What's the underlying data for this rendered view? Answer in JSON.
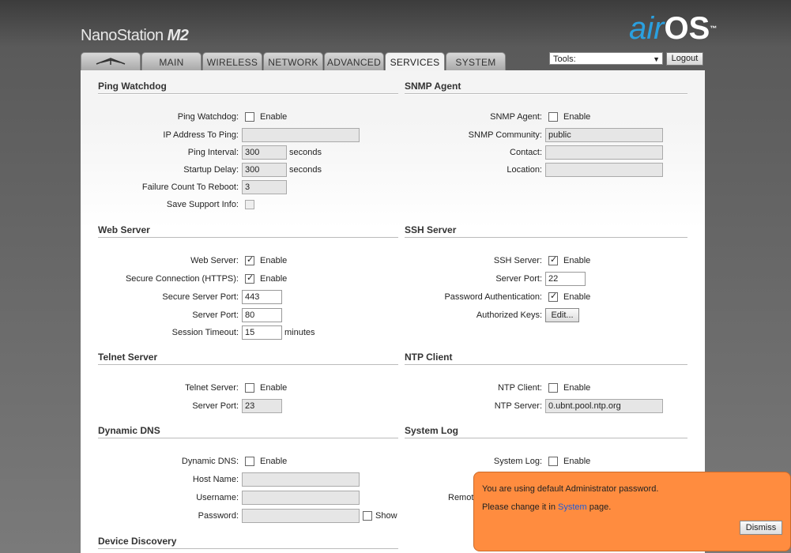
{
  "header": {
    "product_name": "NanoStation",
    "product_model": "M2",
    "logo_air": "air",
    "logo_os": "OS",
    "logo_tm": "™"
  },
  "tabs": [
    {
      "label": "",
      "icon": "ubiquiti-logo-icon"
    },
    {
      "label": "MAIN"
    },
    {
      "label": "WIRELESS"
    },
    {
      "label": "NETWORK"
    },
    {
      "label": "ADVANCED"
    },
    {
      "label": "SERVICES"
    },
    {
      "label": "SYSTEM"
    }
  ],
  "tools": {
    "selected": "Tools:"
  },
  "logout_label": "Logout",
  "ping_watchdog": {
    "title": "Ping Watchdog",
    "enable_label": "Ping Watchdog:",
    "enable_text": "Enable",
    "ip_label": "IP Address To Ping:",
    "ip_value": "",
    "interval_label": "Ping Interval:",
    "interval_value": "300",
    "interval_unit": "seconds",
    "startup_label": "Startup Delay:",
    "startup_value": "300",
    "startup_unit": "seconds",
    "failure_label": "Failure Count To Reboot:",
    "failure_value": "3",
    "support_label": "Save Support Info:"
  },
  "snmp": {
    "title": "SNMP Agent",
    "enable_label": "SNMP Agent:",
    "enable_text": "Enable",
    "community_label": "SNMP Community:",
    "community_value": "public",
    "contact_label": "Contact:",
    "contact_value": "",
    "location_label": "Location:",
    "location_value": ""
  },
  "web_server": {
    "title": "Web Server",
    "enable_label": "Web Server:",
    "enable_text": "Enable",
    "https_label": "Secure Connection (HTTPS):",
    "https_text": "Enable",
    "secure_port_label": "Secure Server Port:",
    "secure_port_value": "443",
    "port_label": "Server Port:",
    "port_value": "80",
    "timeout_label": "Session Timeout:",
    "timeout_value": "15",
    "timeout_unit": "minutes"
  },
  "ssh_server": {
    "title": "SSH Server",
    "enable_label": "SSH Server:",
    "enable_text": "Enable",
    "port_label": "Server Port:",
    "port_value": "22",
    "pwauth_label": "Password Authentication:",
    "pwauth_text": "Enable",
    "keys_label": "Authorized Keys:",
    "keys_button": "Edit..."
  },
  "telnet": {
    "title": "Telnet Server",
    "enable_label": "Telnet Server:",
    "enable_text": "Enable",
    "port_label": "Server Port:",
    "port_value": "23"
  },
  "ntp": {
    "title": "NTP Client",
    "enable_label": "NTP Client:",
    "enable_text": "Enable",
    "server_label": "NTP Server:",
    "server_value": "0.ubnt.pool.ntp.org"
  },
  "ddns": {
    "title": "Dynamic DNS",
    "enable_label": "Dynamic DNS:",
    "enable_text": "Enable",
    "host_label": "Host Name:",
    "host_value": "",
    "user_label": "Username:",
    "user_value": "",
    "pass_label": "Password:",
    "pass_value": "",
    "show_text": "Show"
  },
  "syslog": {
    "title": "System Log",
    "enable_label": "System Log:",
    "enable_text": "Enable",
    "remote_label_partial": "Remot"
  },
  "discovery": {
    "title": "Device Discovery"
  },
  "toast": {
    "line1": "You are using default Administrator password.",
    "line2_prefix": "Please change it in ",
    "line2_link": "System",
    "line2_suffix": " page.",
    "dismiss": "Dismiss"
  }
}
